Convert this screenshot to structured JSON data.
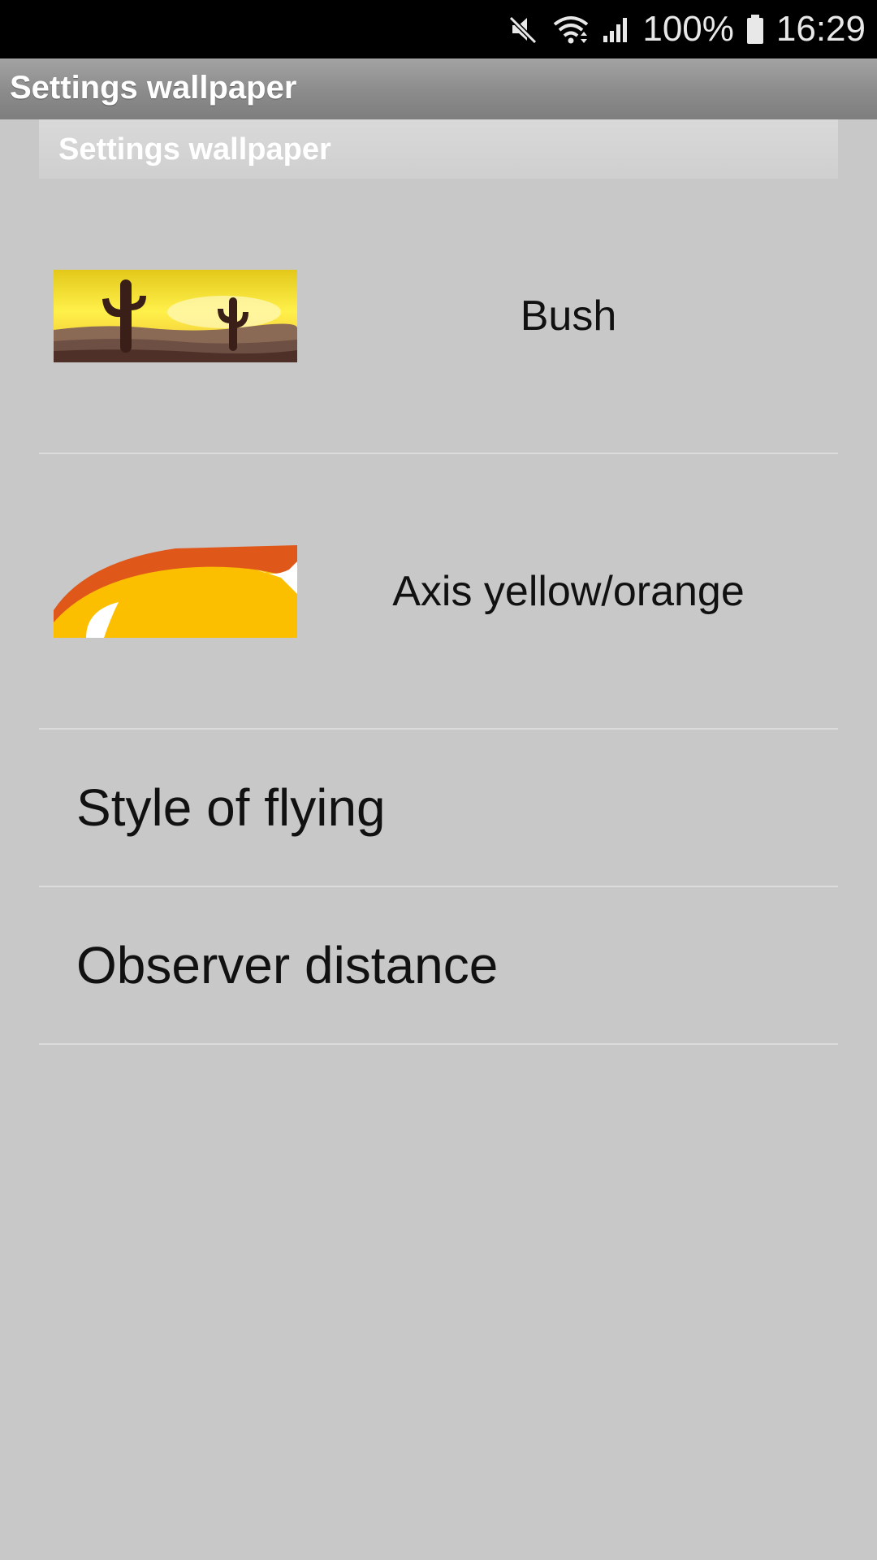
{
  "status_bar": {
    "battery_text": "100%",
    "time": "16:29",
    "icons": [
      "mute-icon",
      "wifi-icon",
      "signal-icon",
      "battery-icon"
    ]
  },
  "action_bar": {
    "title": "Settings wallpaper"
  },
  "section": {
    "title": "Settings wallpaper"
  },
  "items": [
    {
      "label": "Bush",
      "icon": "cactus-thumbnail"
    },
    {
      "label": "Axis yellow/orange",
      "icon": "yellow-orange-thumbnail"
    },
    {
      "label": "Style of flying"
    },
    {
      "label": "Observer distance"
    }
  ],
  "colors": {
    "background": "#c8c8c8",
    "status_bar": "#000000",
    "action_bar": "#8b8b8b",
    "divider": "#dcdcdc"
  }
}
